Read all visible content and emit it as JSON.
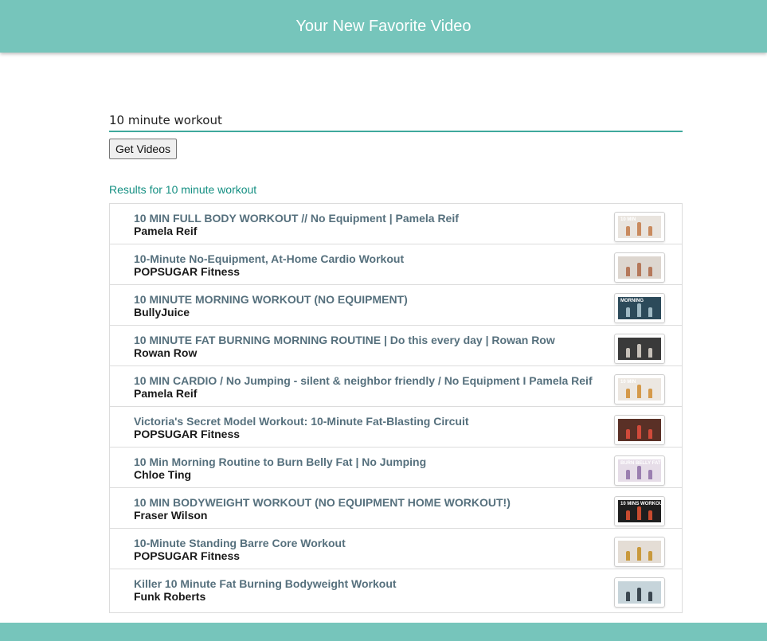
{
  "header": {
    "title": "Your New Favorite Video"
  },
  "search": {
    "value": "10 minute workout",
    "button_label": "Get Videos"
  },
  "results": {
    "label": "Results for 10 minute workout",
    "items": [
      {
        "title": "10 MIN FULL BODY WORKOUT // No Equipment | Pamela Reif",
        "channel": "Pamela Reif",
        "thumb_bg": "#e9e4de",
        "thumb_accent": "#c98a5e",
        "thumb_text": "10 MIN"
      },
      {
        "title": "10-Minute No-Equipment, At-Home Cardio Workout",
        "channel": "POPSUGAR Fitness",
        "thumb_bg": "#ddd6cf",
        "thumb_accent": "#b5785a",
        "thumb_text": ""
      },
      {
        "title": "10 MINUTE MORNING WORKOUT (NO EQUIPMENT)",
        "channel": "BullyJuice",
        "thumb_bg": "#2c4a5a",
        "thumb_accent": "#9fb9c4",
        "thumb_text": "MORNING"
      },
      {
        "title": "10 MINUTE FAT BURNING MORNING ROUTINE | Do this every day | Rowan Row",
        "channel": "Rowan Row",
        "thumb_bg": "#3a3a3a",
        "thumb_accent": "#c7c1b9",
        "thumb_text": ""
      },
      {
        "title": "10 MIN CARDIO / No Jumping - silent & neighbor friendly / No Equipment I Pamela Reif",
        "channel": "Pamela Reif",
        "thumb_bg": "#ece7e1",
        "thumb_accent": "#d59a4b",
        "thumb_text": "10 MIN"
      },
      {
        "title": "Victoria's Secret Model Workout: 10-Minute Fat-Blasting Circuit",
        "channel": "POPSUGAR Fitness",
        "thumb_bg": "#5a3026",
        "thumb_accent": "#d14a3a",
        "thumb_text": ""
      },
      {
        "title": "10 Min Morning Routine to Burn Belly Fat | No Jumping",
        "channel": "Chloe Ting",
        "thumb_bg": "#e6dde8",
        "thumb_accent": "#9b7fb0",
        "thumb_text": "BURN BELLY FAT"
      },
      {
        "title": "10 MIN BODYWEIGHT WORKOUT (NO EQUIPMENT HOME WORKOUT!)",
        "channel": "Fraser Wilson",
        "thumb_bg": "#1e1e1e",
        "thumb_accent": "#c84b2f",
        "thumb_text": "10 MINS WORKOUT"
      },
      {
        "title": "10-Minute Standing Barre Core Workout",
        "channel": "POPSUGAR Fitness",
        "thumb_bg": "#e4ddd5",
        "thumb_accent": "#c9993c",
        "thumb_text": ""
      },
      {
        "title": "Killer 10 Minute Fat Burning Bodyweight Workout",
        "channel": "Funk Roberts",
        "thumb_bg": "#c6d4da",
        "thumb_accent": "#3b4750",
        "thumb_text": ""
      }
    ]
  }
}
